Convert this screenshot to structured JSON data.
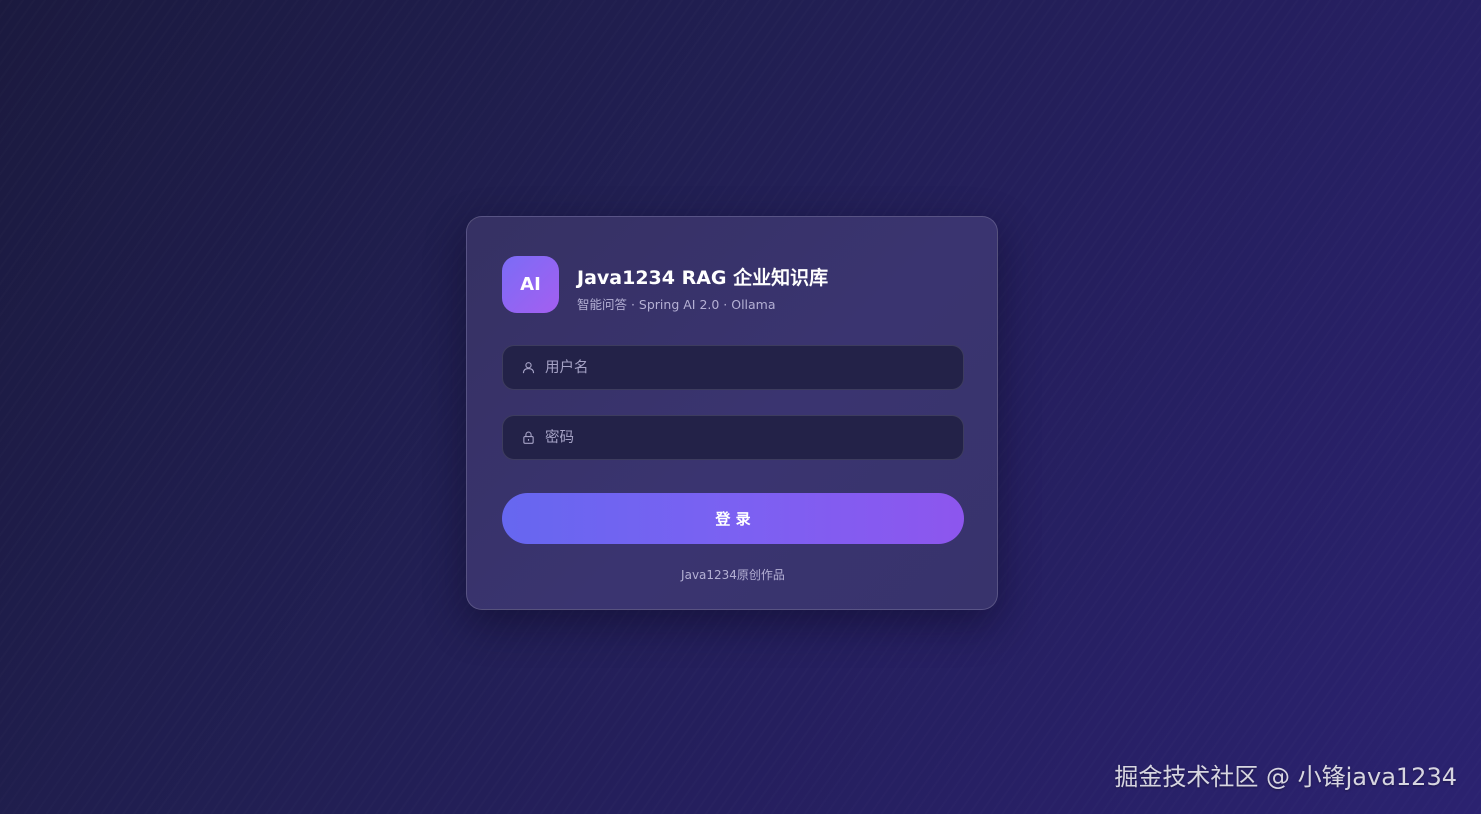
{
  "brand": {
    "logo_text": "AI",
    "title": "Java1234 RAG 企业知识库",
    "subtitle": "智能问答 · Spring AI 2.0 · Ollama"
  },
  "form": {
    "username": {
      "placeholder": "用户名",
      "value": "",
      "icon": "user-icon"
    },
    "password": {
      "placeholder": "密码",
      "value": "",
      "icon": "lock-icon"
    },
    "login_label": "登 录"
  },
  "footer": {
    "credit": "Java1234原创作品"
  },
  "watermark": "掘金技术社区 @ 小锋java1234",
  "colors": {
    "background": "#211f52",
    "card": "#38336c",
    "accent_start": "#6667f0",
    "accent_end": "#8d56ee",
    "input_bg": "#232248"
  }
}
